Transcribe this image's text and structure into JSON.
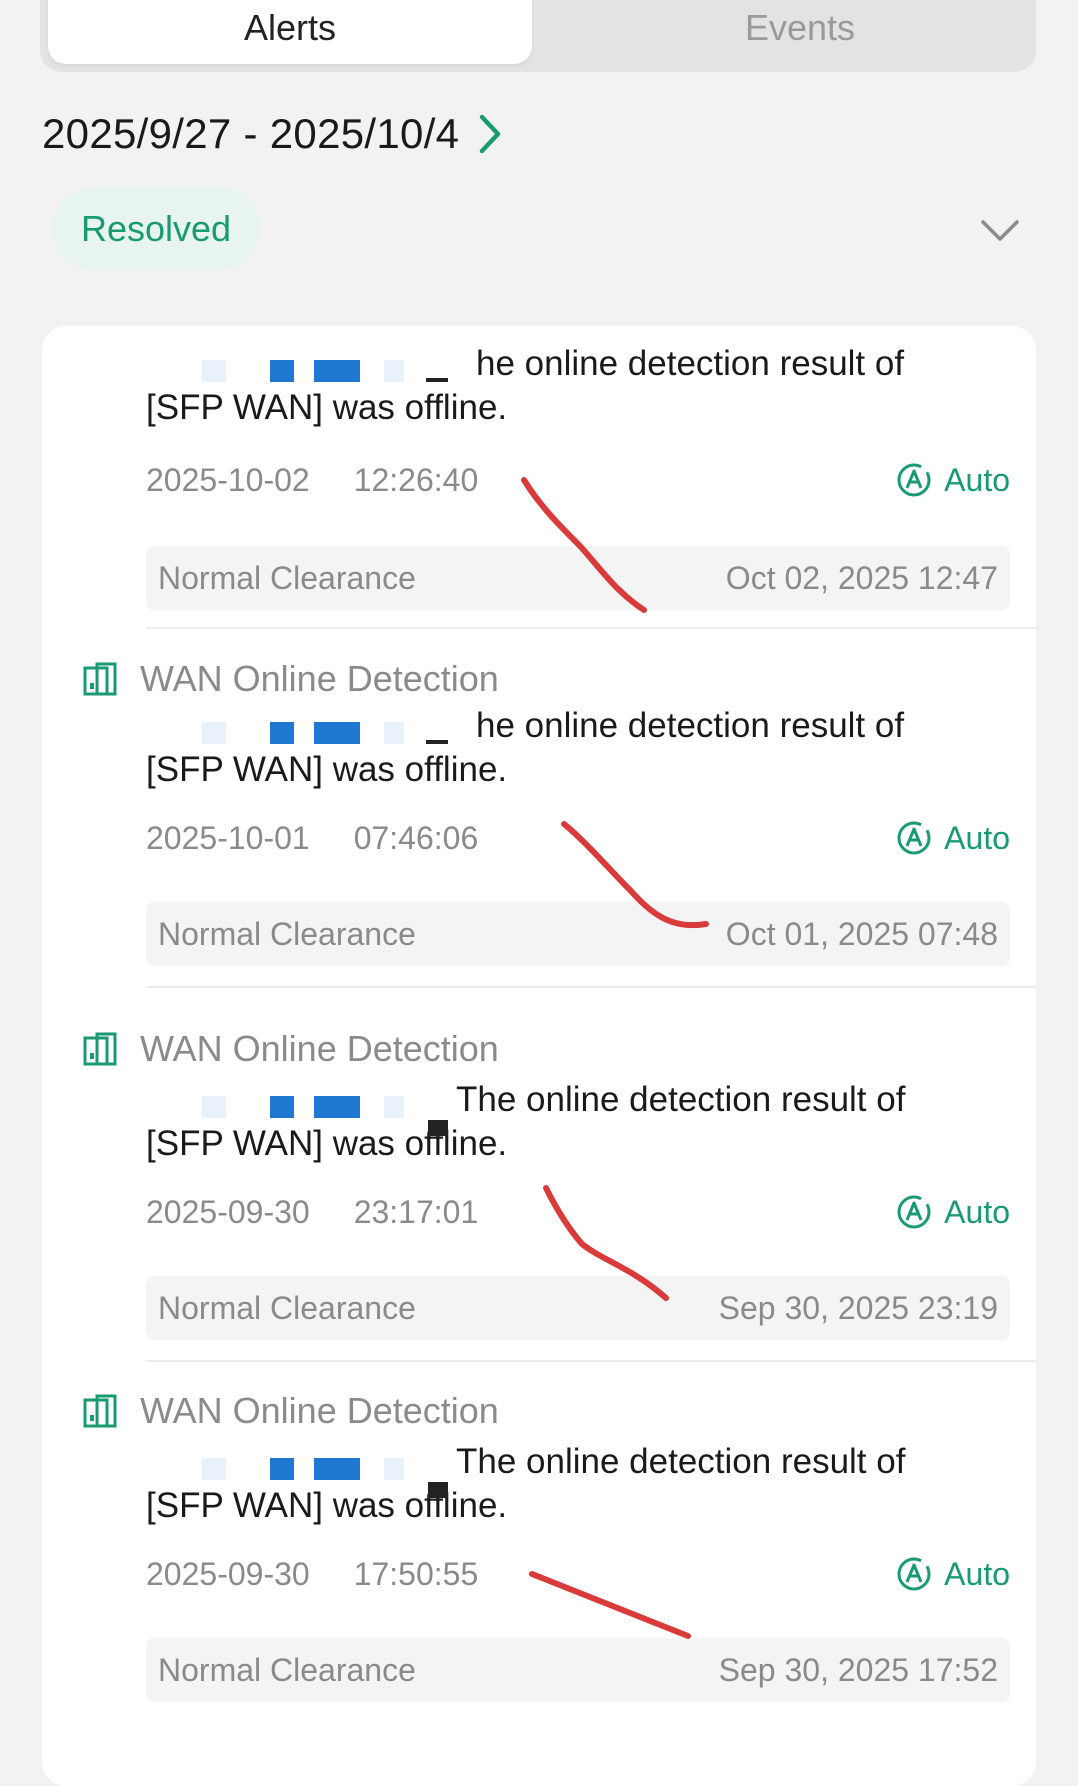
{
  "tabs": [
    {
      "label": "Alerts",
      "active": true
    },
    {
      "label": "Events",
      "active": false
    }
  ],
  "date_range": "2025/9/27 - 2025/10/4",
  "filter": {
    "label": "Resolved"
  },
  "alerts": [
    {
      "title": "",
      "message_line1": "he online detection result of",
      "message_line2": "[SFP WAN] was offline.",
      "date": "2025-10-02",
      "time": "12:26:40",
      "mode": "Auto",
      "clearance": "Normal Clearance",
      "cleared_at": "Oct 02, 2025 12:47"
    },
    {
      "title": "WAN Online Detection",
      "message_line1": "he online detection result of",
      "message_line2": "[SFP WAN] was offline.",
      "date": "2025-10-01",
      "time": "07:46:06",
      "mode": "Auto",
      "clearance": "Normal Clearance",
      "cleared_at": "Oct 01, 2025 07:48"
    },
    {
      "title": "WAN Online Detection",
      "message_line1": "The online detection result of",
      "message_line2": "[SFP WAN] was offline.",
      "date": "2025-09-30",
      "time": "23:17:01",
      "mode": "Auto",
      "clearance": "Normal Clearance",
      "cleared_at": "Sep 30, 2025 23:19"
    },
    {
      "title": "WAN Online Detection",
      "message_line1": "The online detection result of",
      "message_line2": "[SFP WAN] was offline.",
      "date": "2025-09-30",
      "time": "17:50:55",
      "mode": "Auto",
      "clearance": "Normal Clearance",
      "cleared_at": "Sep 30, 2025 17:52"
    }
  ],
  "colors": {
    "accent": "#1a9a73",
    "scribble": "#d93a3a",
    "redaction": "#1f77d0"
  }
}
